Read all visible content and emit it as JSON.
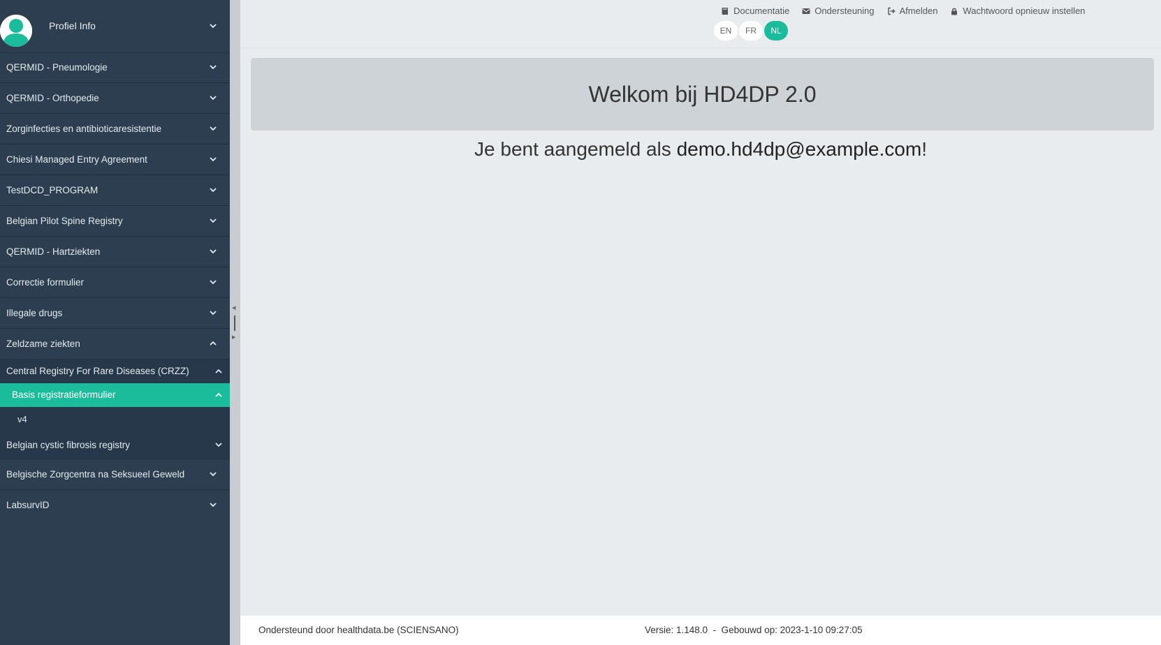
{
  "profile": {
    "label": "Profiel Info"
  },
  "menu": {
    "items": [
      "QERMID - Pneumologie",
      "QERMID - Orthopedie",
      "Zorginfecties en antibioticaresistentie",
      "Chiesi Managed Entry Agreement",
      "TestDCD_PROGRAM",
      "Belgian Pilot Spine Registry",
      "QERMID - Hartziekten",
      "Correctie formulier",
      "Illegale drugs",
      "Zeldzame ziekten"
    ],
    "sub_item": "Central Registry For Rare Diseases (CRZZ)",
    "active_item": "Basis registratieformulier",
    "leaf_item": "v4",
    "after_items": [
      "Belgian cystic fibrosis registry",
      "Belgische Zorgcentra na Seksueel Geweld",
      "LabsurvID"
    ]
  },
  "topbar": {
    "links": {
      "documentation": "Documentatie",
      "support": "Ondersteuning",
      "logout": "Afmelden",
      "reset_password": "Wachtwoord opnieuw instellen"
    },
    "languages": [
      "EN",
      "FR",
      "NL"
    ],
    "active_language": "NL"
  },
  "main": {
    "welcome": "Welkom bij HD4DP 2.0",
    "logged_in_prefix": "Je bent aangemeld als ",
    "user": "demo.hd4dp@example.com",
    "logged_in_suffix": "!"
  },
  "footer": {
    "supported_by": "Ondersteund door healthdata.be (SCIENSANO)",
    "version": "Versie: 1.148.0  -  Gebouwd op: 2023-1-10 09:27:05"
  },
  "colors": {
    "sidebar": "#2c3e50",
    "accent": "#1abc9c",
    "background": "#e9ecef"
  }
}
